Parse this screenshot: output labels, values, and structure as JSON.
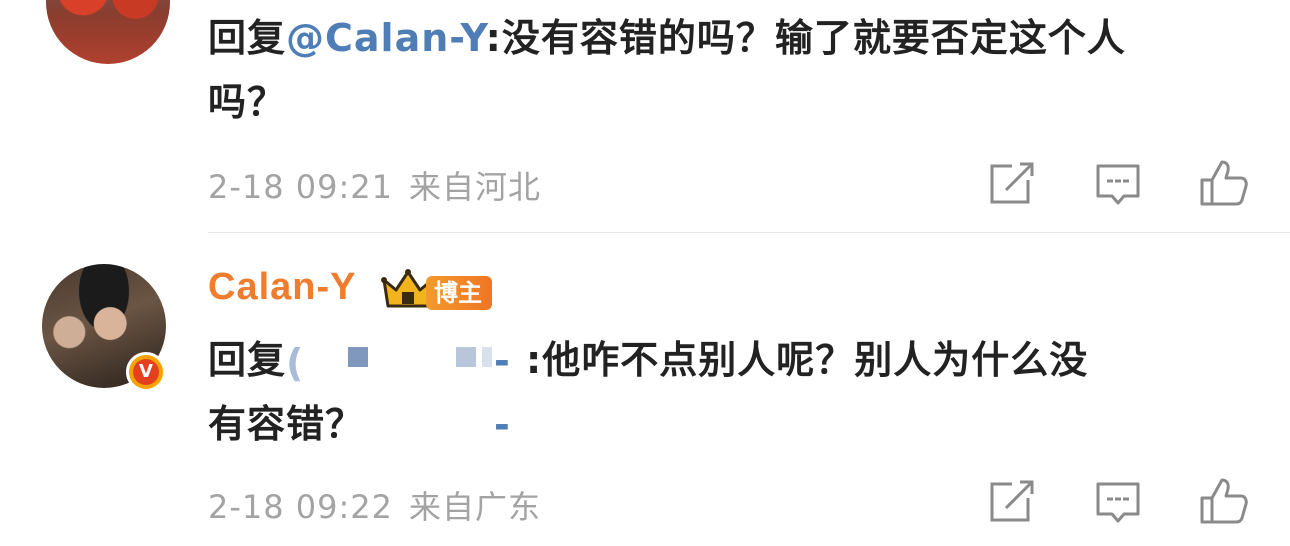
{
  "comments": [
    {
      "reply_prefix": "回复",
      "mention": "@Calan-Y",
      "text_line1_rest": ":没有容错的吗？输了就要否定这个人",
      "text_line2": "吗？",
      "date": "2-18 09:21",
      "location": "来自河北"
    },
    {
      "username": "Calan-Y",
      "badge": "博主",
      "reply_prefix": "回复",
      "mention_paren": "(",
      "mention_tail": "--",
      "text_line1_rest": ":他咋不点别人呢？别人为什么没",
      "text_line2": "有容错？",
      "date": "2-18 09:22",
      "location": "来自广东"
    }
  ],
  "verified_badge_letter": "V",
  "colors": {
    "mention": "#4f7db5",
    "username": "#f07c2d",
    "meta": "#a3a3a3",
    "badge_bg": "#f07524"
  },
  "icons": [
    "share-icon",
    "comment-icon",
    "like-icon",
    "crown-icon",
    "verified-badge-icon"
  ]
}
